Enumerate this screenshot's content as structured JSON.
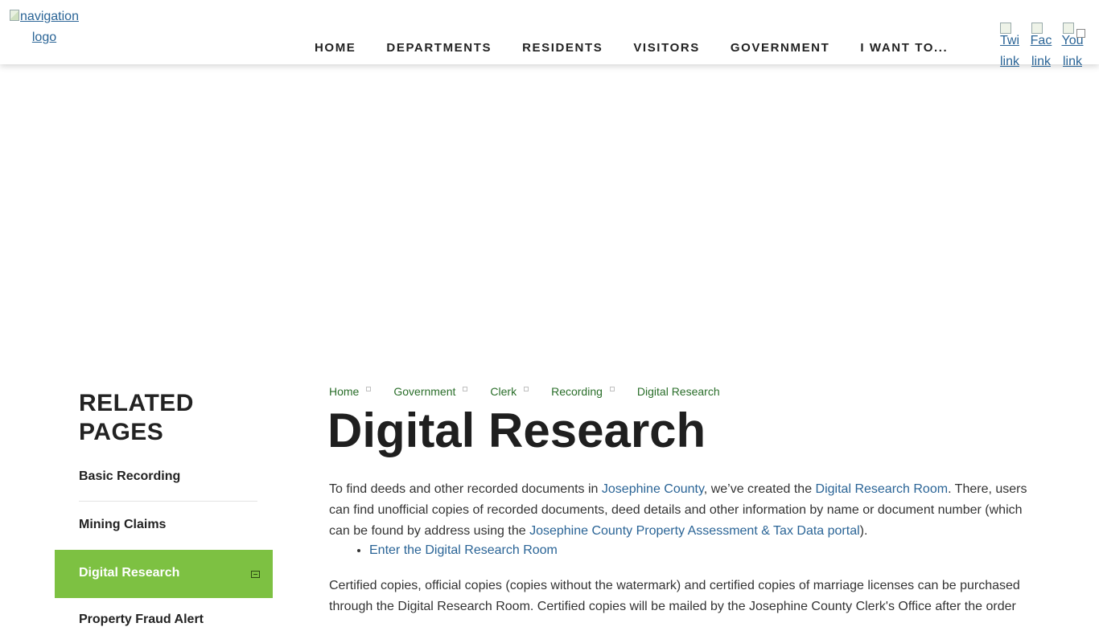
{
  "header": {
    "logo_alt": "navigation logo",
    "nav": [
      "HOME",
      "DEPARTMENTS",
      "RESIDENTS",
      "VISITORS",
      "GOVERNMENT",
      "I WANT TO..."
    ],
    "social": [
      {
        "alt1": "Twi",
        "alt2": "link"
      },
      {
        "alt1": "Fac",
        "alt2": "link"
      },
      {
        "alt1": "You",
        "alt2": "link"
      }
    ]
  },
  "sidebar": {
    "title": "RELATED PAGES",
    "items": [
      "Basic Recording",
      "Mining Claims",
      "Digital Research",
      "Property Fraud Alert"
    ],
    "active_color": "#7dc142"
  },
  "breadcrumb": [
    "Home",
    "Government",
    "Clerk",
    "Recording",
    "Digital Research"
  ],
  "page_title": "Digital Research",
  "body": {
    "p1_a": "To find deeds and other recorded documents in ",
    "p1_link1": "Josephine County",
    "p1_b": ", we’ve created the ",
    "p1_link2": "Digital Research Room",
    "p1_c": ". There, users can find unofficial copies of recorded documents, deed details and other information by name or document number (which can be found by address using the ",
    "p1_link3": "Josephine County Property Assessment & Tax Data portal",
    "p1_d": ").",
    "list_item": "Enter the Digital Research Room",
    "p2": "Certified copies, official copies (copies without the watermark) and certified copies of marriage licenses can be purchased through the Digital Research Room. Certified copies will be mailed by the Josephine County Clerk's Office after the order"
  }
}
